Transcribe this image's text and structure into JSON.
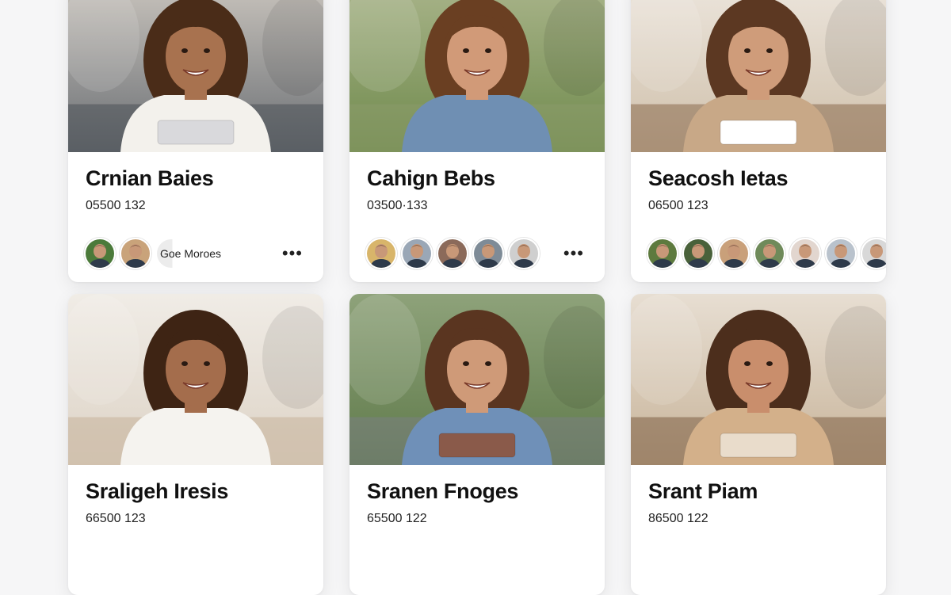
{
  "cards": [
    {
      "name": "Crnian Baies",
      "code": "05500 132",
      "group_label": "Goe Moroes",
      "more_label": "•••",
      "photo": {
        "bg_top": "#c9c4bd",
        "bg_bottom": "#6b6f74",
        "ground": "#4d5257",
        "hair": "#4a2c18",
        "skin": "#a8724f",
        "shirt": "#f3f1ec",
        "prop": "#d9d9dc"
      },
      "avatars": [
        "#4b7a3a",
        "#c9a37a"
      ]
    },
    {
      "name": "Cahign Bebs",
      "code": "03500·133",
      "more_label": "•••",
      "photo": {
        "bg_top": "#a9b48a",
        "bg_bottom": "#6f8a4c",
        "ground": "#8b9a6a",
        "hair": "#6a3f22",
        "skin": "#d19a78",
        "shirt": "#6f8fb3",
        "prop": "none"
      },
      "avatars": [
        "#d8b56a",
        "#9aa7b6",
        "#8b6a5a",
        "#7e8b97",
        "#cfcfcf"
      ]
    },
    {
      "name": "Seacosh Ietas",
      "code": "06500 123",
      "more_label": "",
      "photo": {
        "bg_top": "#ece5dc",
        "bg_bottom": "#cfc0ab",
        "ground": "#8a6a4d",
        "hair": "#5c3822",
        "skin": "#cf9c7a",
        "shirt": "#c8a887",
        "prop": "#ffffff"
      },
      "avatars": [
        "#5d7a3e",
        "#49613a",
        "#c9a07a",
        "#6f8a5a",
        "#e2d6cf",
        "#b9c2cc",
        "#d8d8d8"
      ]
    },
    {
      "name": "Sraligeh Iresis",
      "code": "66500 123",
      "more_label": "",
      "photo": {
        "bg_top": "#f0ece6",
        "bg_bottom": "#ddd3c6",
        "ground": "#c7b39a",
        "hair": "#3e2414",
        "skin": "#a46d4c",
        "shirt": "#f5f3ef",
        "prop": "none"
      },
      "avatars": []
    },
    {
      "name": "Sranen Fnoges",
      "code": "65500 122",
      "more_label": "",
      "photo": {
        "bg_top": "#8ea27a",
        "bg_bottom": "#5f7a4a",
        "ground": "#7a7f82",
        "hair": "#5a3520",
        "skin": "#cf9a78",
        "shirt": "#6f90b8",
        "prop": "#8a5a4a"
      },
      "avatars": []
    },
    {
      "name": "Srant Piam",
      "code": "86500 122",
      "more_label": "",
      "photo": {
        "bg_top": "#e7ded2",
        "bg_bottom": "#c8b49a",
        "ground": "#7d5f44",
        "hair": "#4c2e1c",
        "skin": "#c98e6c",
        "shirt": "#d3b08a",
        "prop": "#e9dccb"
      },
      "avatars": []
    }
  ]
}
